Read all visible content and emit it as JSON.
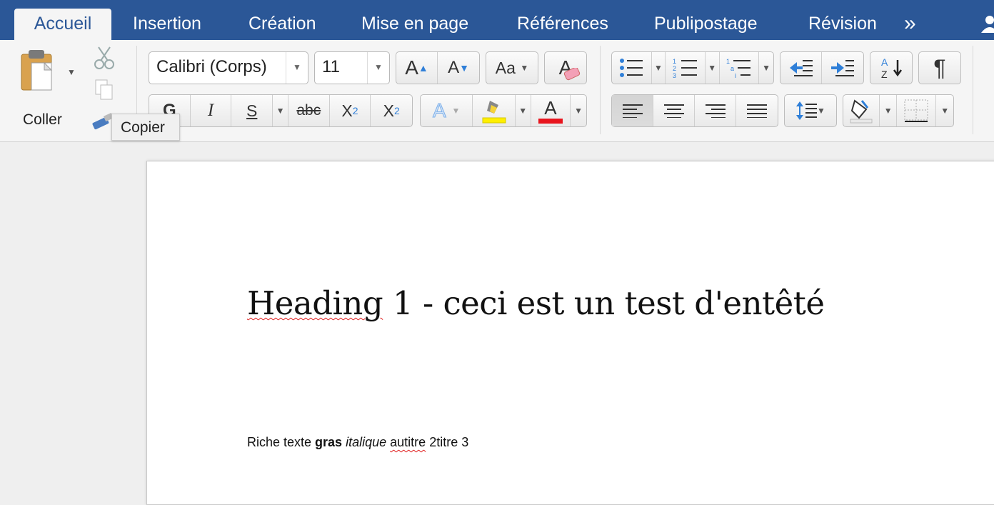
{
  "tabs": [
    {
      "label": "Accueil",
      "active": true
    },
    {
      "label": "Insertion"
    },
    {
      "label": "Création"
    },
    {
      "label": "Mise en page"
    },
    {
      "label": "Références"
    },
    {
      "label": "Publipostage"
    },
    {
      "label": "Révision"
    }
  ],
  "tabs_more": "»",
  "clipboard": {
    "paste_label": "Coller",
    "tooltip": "Copier"
  },
  "font": {
    "name": "Calibri (Corps)",
    "size": "11",
    "bold_label": "G",
    "italic_label": "I",
    "underline_label": "S",
    "strike_label": "abc",
    "sub_label": "X",
    "sub_small": "2",
    "sup_label": "X",
    "sup_small": "2",
    "grow_label": "A",
    "shrink_label": "A",
    "case_label": "Aa",
    "clear_label": "A",
    "effects_label": "A",
    "color_label": "A",
    "highlight_color": "#ffef00",
    "font_color": "#e8141d"
  },
  "paragraph": {
    "pilcrow": "¶"
  },
  "document": {
    "heading_word": "Heading",
    "heading_rest": " 1 - ceci est un test d'entêté",
    "body_plain1": "Riche texte ",
    "body_bold": "gras",
    "body_space": " ",
    "body_italic": "italique",
    "body_space2": " ",
    "body_squiggle": "autitre",
    "body_rest": " 2titre 3"
  },
  "colors": {
    "accent": "#2b5797"
  }
}
